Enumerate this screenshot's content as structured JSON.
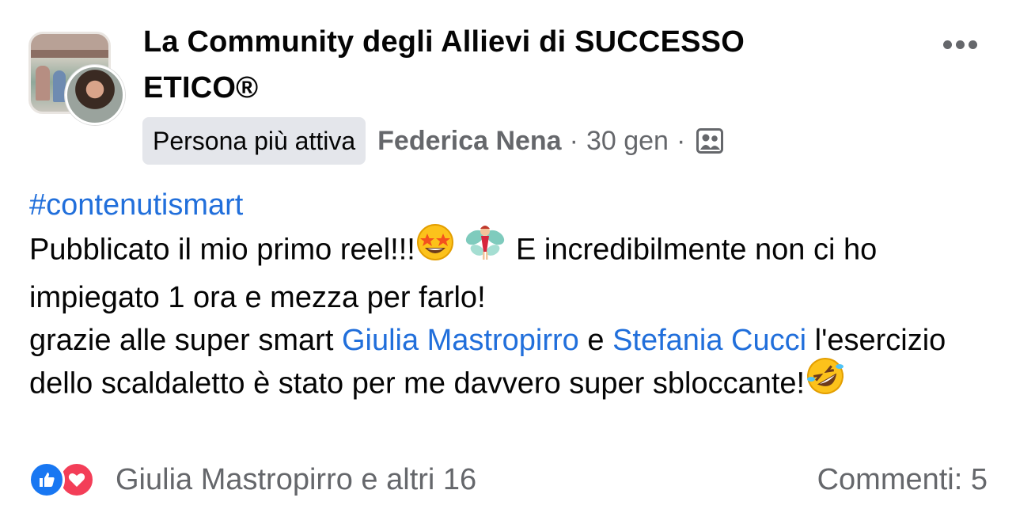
{
  "group": {
    "title": "La Community degli Allievi di SUCCESSO ETICO®"
  },
  "meta": {
    "badge": "Persona più attiva",
    "author": "Federica Nena",
    "separator": "·",
    "date": "30 gen",
    "audience_icon": "group-members-icon"
  },
  "post": {
    "hashtag": "#contenutismart",
    "line1": "Pubblicato il mio primo reel!!!",
    "line1_after": "E incredibilmente non ci ho impiegato 1 ora e mezza per farlo!",
    "line2_pre": "grazie alle super smart ",
    "mention1": "Giulia Mastropirro",
    "conj": " e ",
    "mention2": "Stefania Cucci",
    "line3": "l'esercizio dello scaldaletto è stato per me davvero super sbloccante!"
  },
  "reactions": {
    "summary": "Giulia Mastropirro e altri 16",
    "icons": [
      "like-icon",
      "love-icon"
    ]
  },
  "comments": {
    "label": "Commenti: 5"
  },
  "colors": {
    "link": "#216fdb",
    "secondary_text": "#65676b",
    "badge_bg": "#e4e6eb",
    "like": "#1877f2",
    "love": "#f33e58"
  }
}
